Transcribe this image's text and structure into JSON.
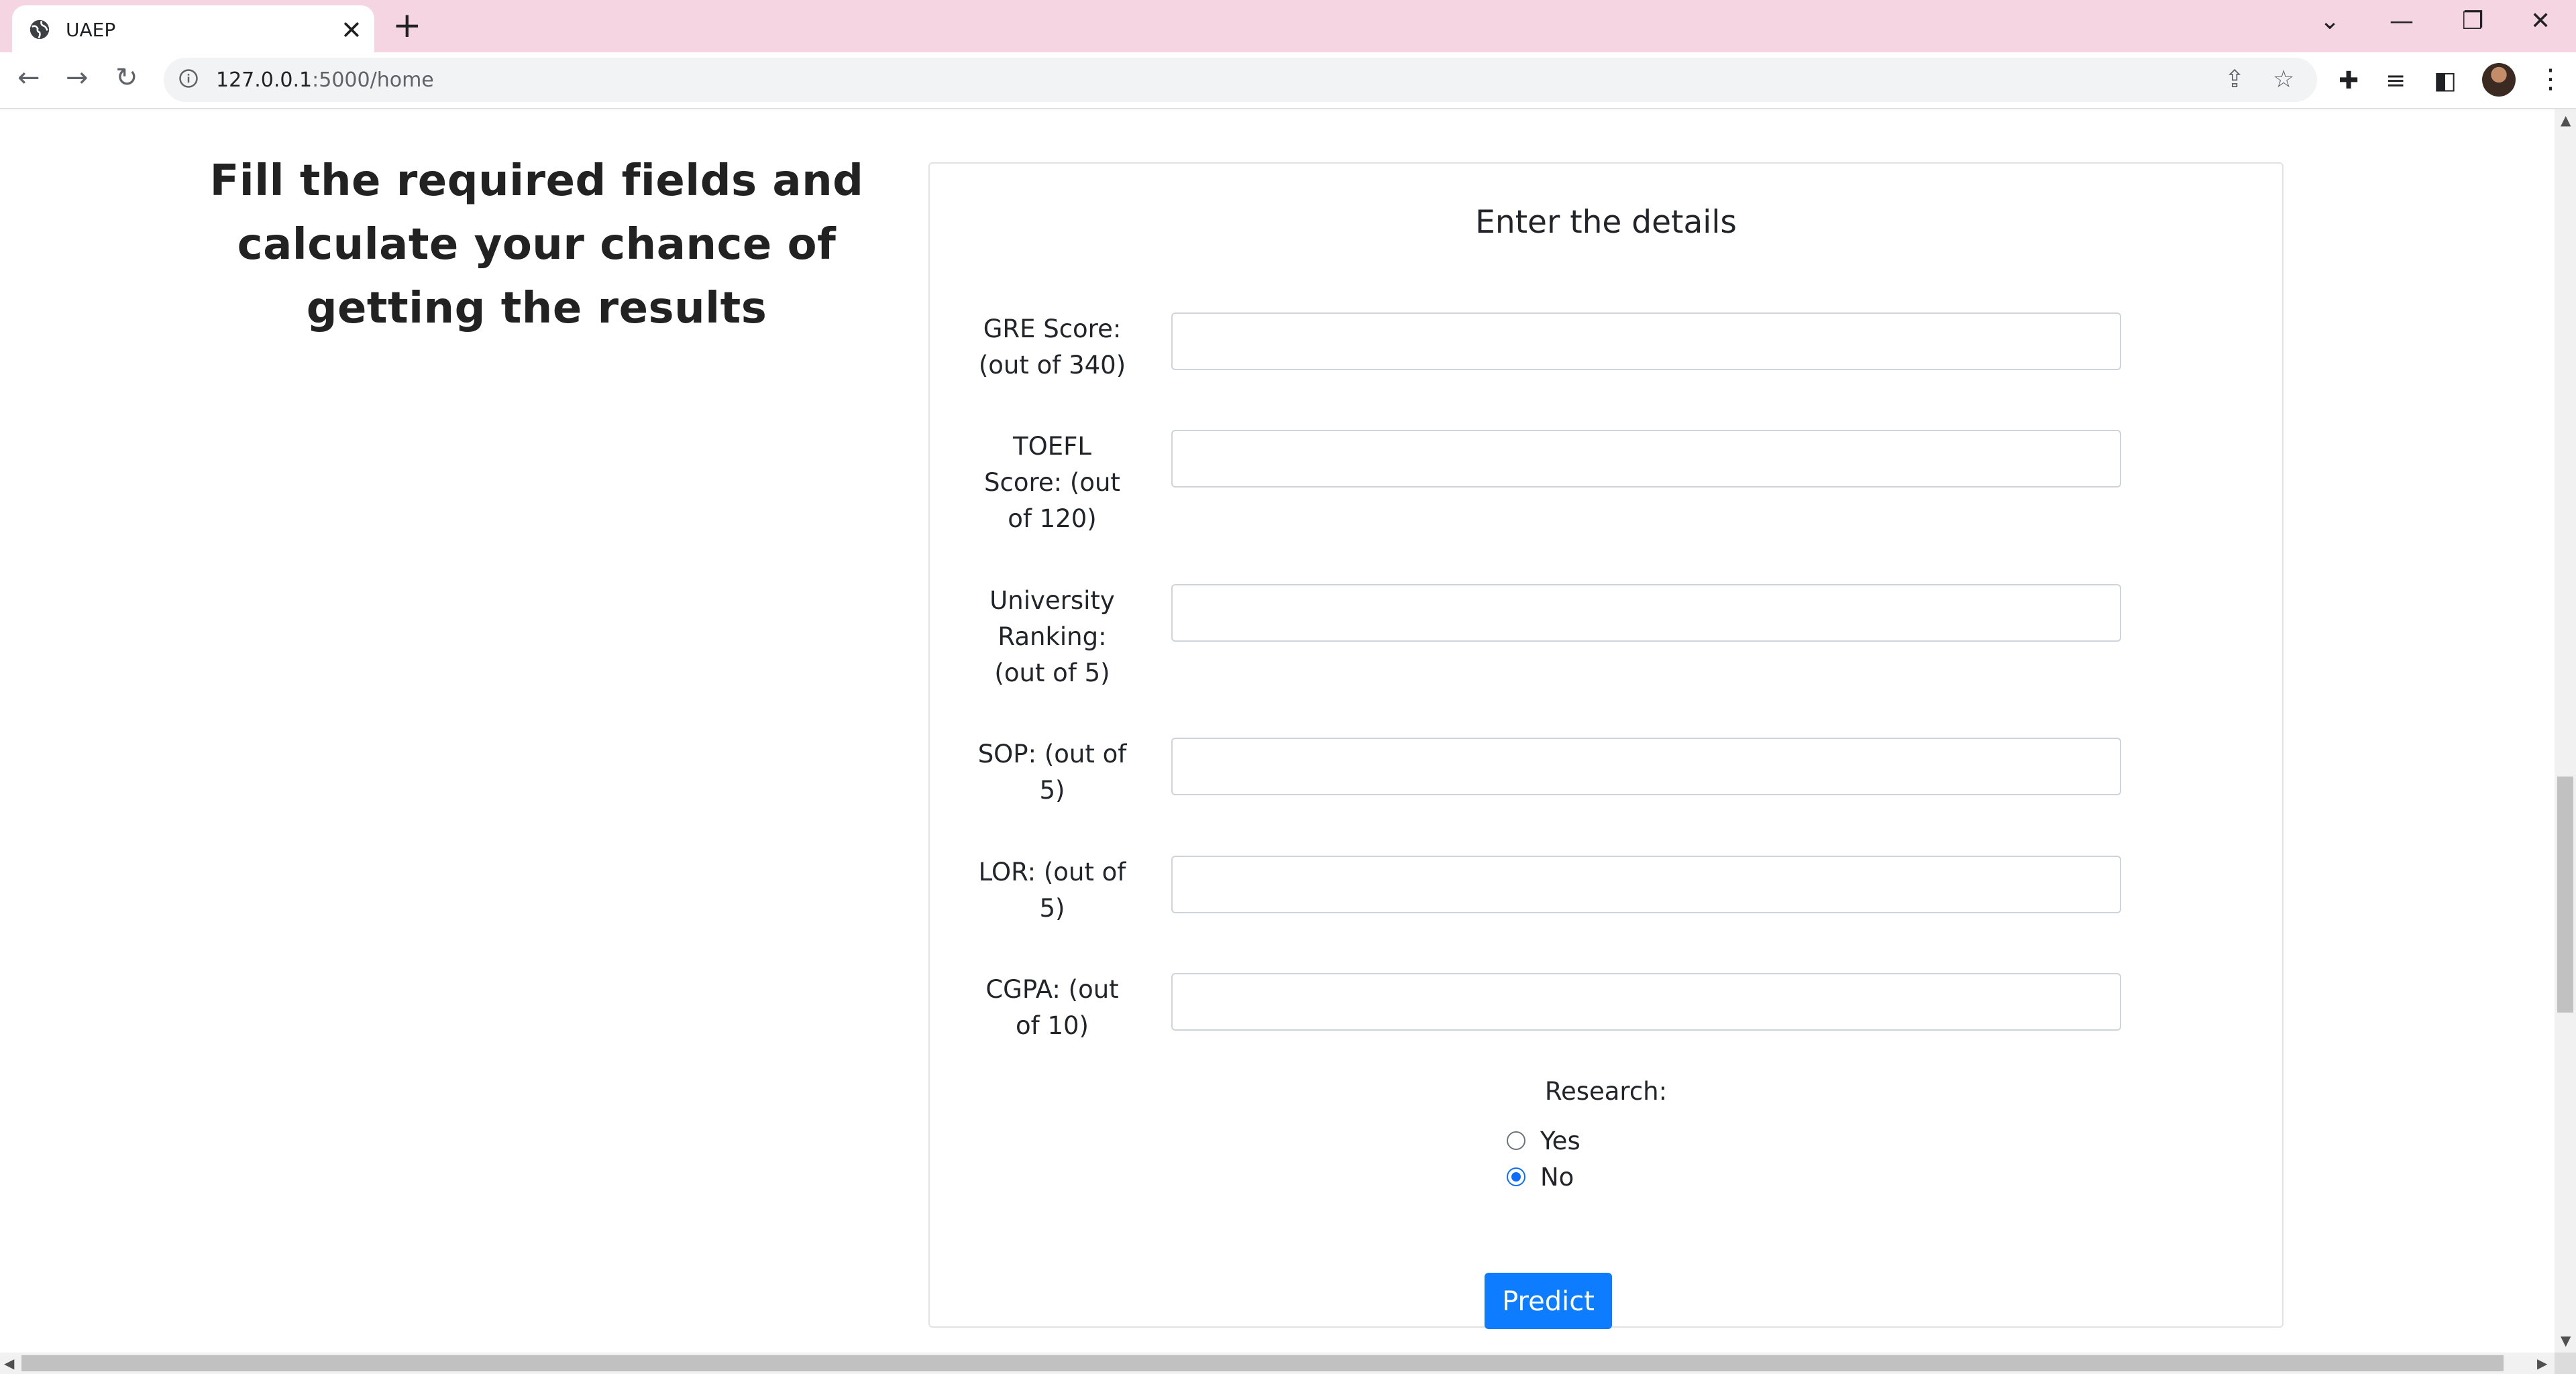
{
  "browser": {
    "tab_title": "UAEP",
    "tab_close": "✕",
    "new_tab": "+",
    "url_host": "127.0.0.1",
    "url_rest": ":5000/home",
    "window_controls": {
      "tab_search": "⌄",
      "minimize": "—",
      "restore": "❐",
      "close": "✕"
    },
    "nav": {
      "back": "←",
      "forward": "→",
      "reload": "↻"
    },
    "omnibox_icons": {
      "share": "⇪",
      "bookmark": "☆"
    },
    "toolbar_icons": {
      "extensions": "✚",
      "media": "≡",
      "side_panel": "◧",
      "menu": "⋮"
    }
  },
  "page": {
    "heading_lines": [
      "Fill the required fields and",
      "calculate your chance of",
      "getting the results"
    ],
    "form": {
      "title": "Enter the details",
      "fields": [
        {
          "label_lines": [
            "GRE Score:",
            "(out of 340)"
          ],
          "value": ""
        },
        {
          "label_lines": [
            "TOEFL",
            "Score: (out",
            "of 120)"
          ],
          "value": ""
        },
        {
          "label_lines": [
            "University",
            "Ranking:",
            "(out of 5)"
          ],
          "value": ""
        },
        {
          "label_lines": [
            "SOP: (out of",
            "5)"
          ],
          "value": ""
        },
        {
          "label_lines": [
            "LOR: (out of",
            "5)"
          ],
          "value": ""
        },
        {
          "label_lines": [
            "CGPA: (out",
            "of 10)"
          ],
          "value": ""
        }
      ],
      "research_label": "Research:",
      "research_options": [
        {
          "label": "Yes",
          "checked": false
        },
        {
          "label": "No",
          "checked": true
        }
      ],
      "submit_label": "Predict"
    }
  },
  "colors": {
    "tabbar": "#f6d5e3",
    "primary_button": "#0d7cff",
    "radio_checked": "#0d6efd"
  }
}
